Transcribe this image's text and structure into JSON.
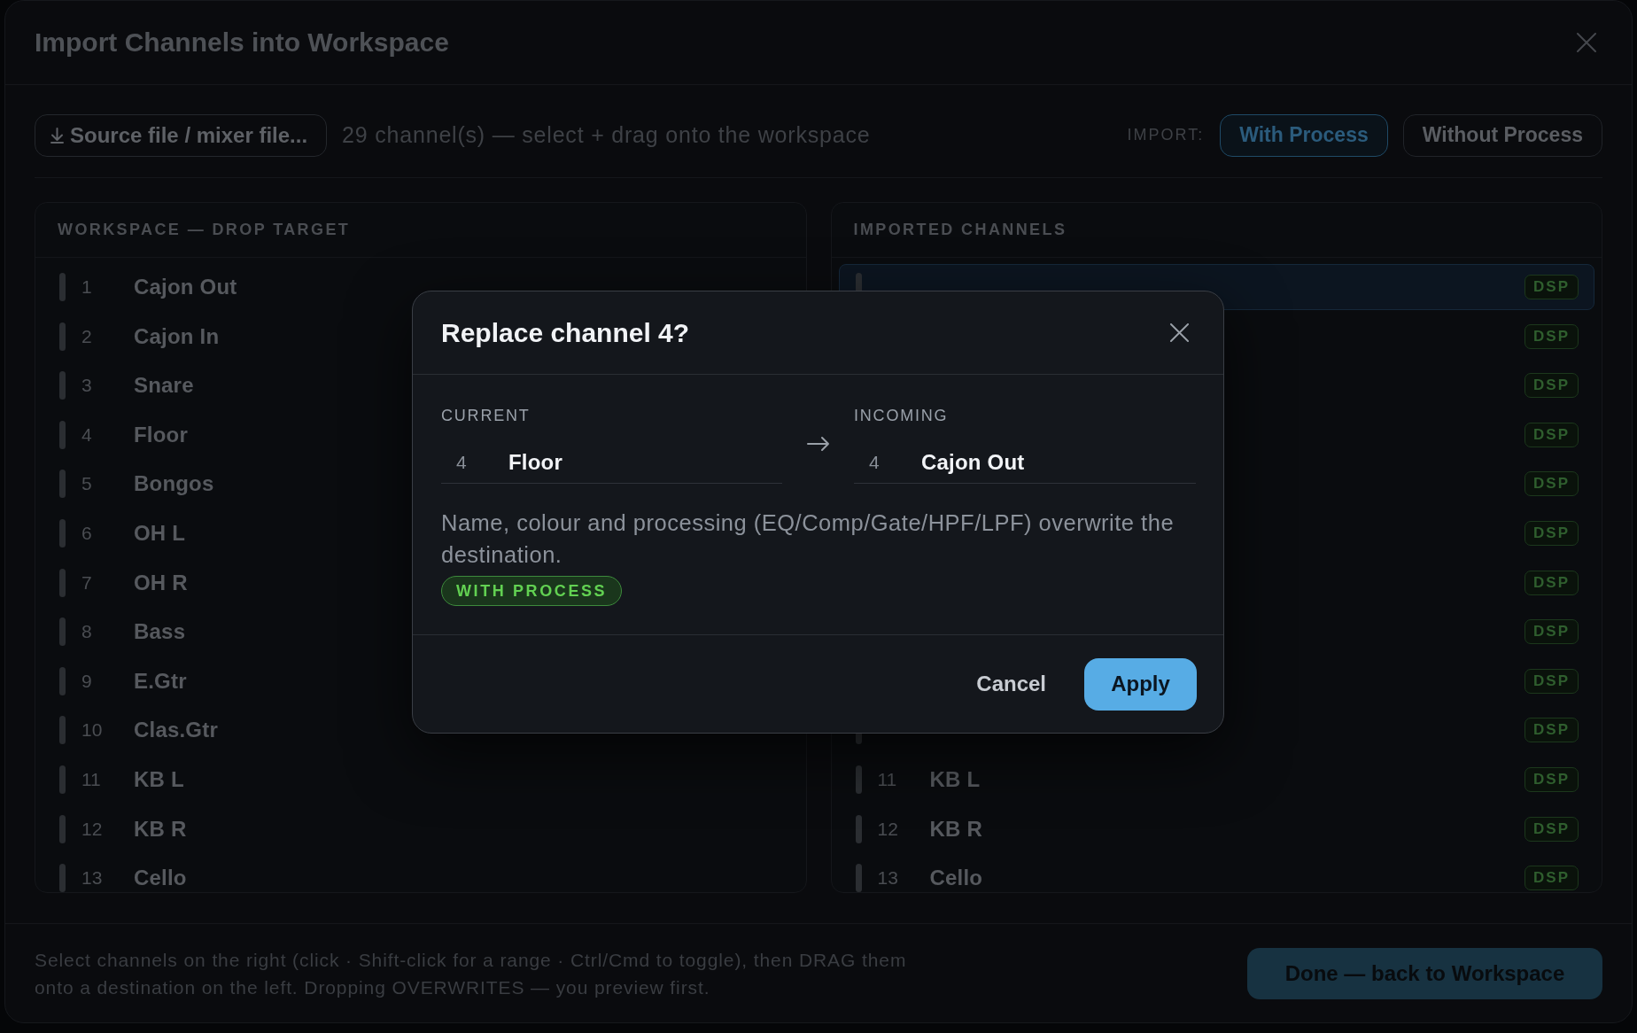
{
  "dialog": {
    "title": "Import Channels into Workspace"
  },
  "toolbar": {
    "source_button": "Source file / mixer file...",
    "status": "29 channel(s) — select + drag onto the workspace",
    "import_label": "IMPORT:",
    "import_modes": [
      {
        "label": "With Process",
        "selected": true
      },
      {
        "label": "Without Process",
        "selected": false
      }
    ]
  },
  "workspace_panel": {
    "title": "WORKSPACE — DROP TARGET",
    "channels": [
      {
        "number": "1",
        "name": "Cajon Out"
      },
      {
        "number": "2",
        "name": "Cajon In"
      },
      {
        "number": "3",
        "name": "Snare"
      },
      {
        "number": "4",
        "name": "Floor"
      },
      {
        "number": "5",
        "name": "Bongos"
      },
      {
        "number": "6",
        "name": "OH L"
      },
      {
        "number": "7",
        "name": "OH R"
      },
      {
        "number": "8",
        "name": "Bass"
      },
      {
        "number": "9",
        "name": "E.Gtr"
      },
      {
        "number": "10",
        "name": "Clas.Gtr"
      },
      {
        "number": "11",
        "name": "KB L"
      },
      {
        "number": "12",
        "name": "KB R"
      },
      {
        "number": "13",
        "name": "Cello"
      }
    ]
  },
  "imported_panel": {
    "title": "IMPORTED CHANNELS",
    "channels": [
      {
        "badge": "DSP",
        "selected": true
      },
      {
        "badge": "DSP",
        "selected": false
      },
      {
        "badge": "DSP",
        "selected": false
      },
      {
        "badge": "DSP",
        "selected": false
      },
      {
        "badge": "DSP",
        "selected": false
      },
      {
        "badge": "DSP",
        "selected": false
      },
      {
        "badge": "DSP",
        "selected": false
      },
      {
        "badge": "DSP",
        "selected": false
      },
      {
        "badge": "DSP",
        "selected": false
      },
      {
        "badge": "DSP",
        "selected": false
      },
      {
        "number": "11",
        "name": "KB L",
        "badge": "DSP",
        "selected": false
      },
      {
        "number": "12",
        "name": "KB R",
        "badge": "DSP",
        "selected": false
      },
      {
        "number": "13",
        "name": "Cello",
        "badge": "DSP",
        "selected": false
      }
    ]
  },
  "footer": {
    "hint": "Select channels on the right (click · Shift-click for a range · Ctrl/Cmd to toggle), then DRAG them onto a destination on the left. Dropping OVERWRITES — you preview first.",
    "done_button": "Done — back to Workspace"
  },
  "confirm_modal": {
    "title": "Replace channel 4?",
    "current": {
      "label": "CURRENT",
      "number": "4",
      "name": "Floor"
    },
    "incoming": {
      "label": "INCOMING",
      "number": "4",
      "name": "Cajon Out"
    },
    "description": "Name, colour and processing (EQ/Comp/Gate/HPF/LPF) overwrite the destination.",
    "mode_badge": "WITH PROCESS",
    "buttons": [
      {
        "label": "Cancel",
        "kind": "secondary"
      },
      {
        "label": "Apply",
        "kind": "primary"
      }
    ]
  }
}
